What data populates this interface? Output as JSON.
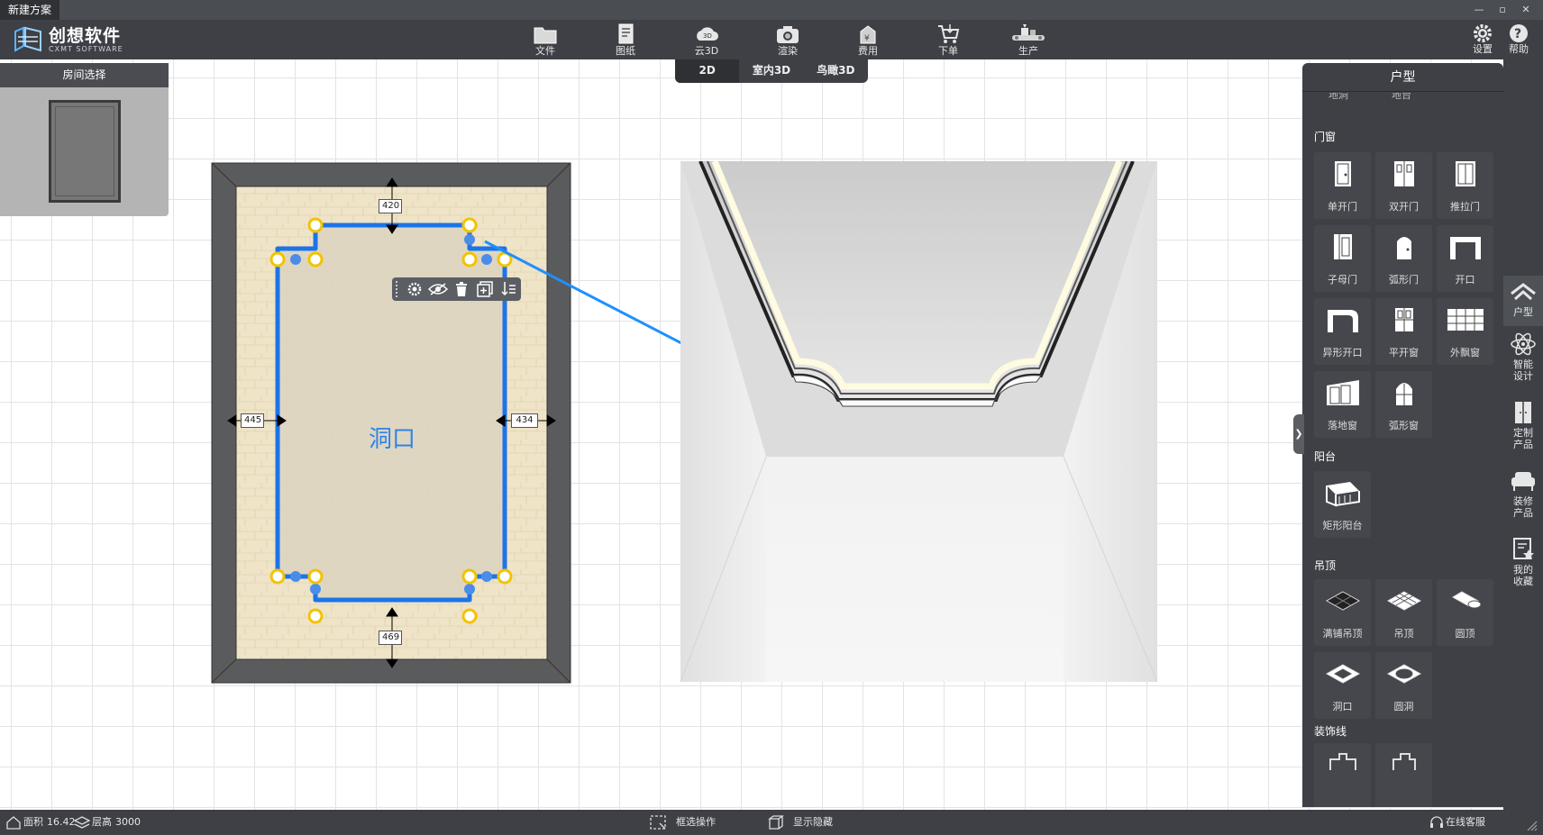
{
  "window": {
    "title": "新建方案",
    "controls": [
      "—",
      "▫",
      "✕"
    ]
  },
  "logo": {
    "main": "创想软件",
    "sub": "CXMT SOFTWARE"
  },
  "toolbar": [
    {
      "label": "文件",
      "icon": "folder-icon"
    },
    {
      "label": "图纸",
      "icon": "drawing-icon"
    },
    {
      "label": "云3D",
      "icon": "cloud-3d-icon"
    },
    {
      "label": "渲染",
      "icon": "camera-icon"
    },
    {
      "label": "费用",
      "icon": "cost-icon"
    },
    {
      "label": "下单",
      "icon": "cart-icon"
    },
    {
      "label": "生产",
      "icon": "production-icon"
    }
  ],
  "toolbar_right": [
    {
      "label": "设置",
      "icon": "gear-icon"
    },
    {
      "label": "帮助",
      "icon": "help-icon"
    }
  ],
  "view_tabs": [
    {
      "label": "2D",
      "active": true
    },
    {
      "label": "室内3D",
      "active": false
    },
    {
      "label": "鸟瞰3D",
      "active": false
    }
  ],
  "room_select": {
    "title": "房间选择"
  },
  "plan": {
    "label": "洞口",
    "dims": {
      "top": "420",
      "left": "445",
      "right": "434",
      "bottom": "469"
    }
  },
  "ceiling_toolbar": [
    "settings-icon",
    "eye-icon",
    "trash-icon",
    "copy-icon",
    "sort-icon"
  ],
  "right_panel": {
    "title": "户型",
    "partial_labels": [
      "地洞",
      "地台"
    ],
    "sections": [
      {
        "title": "门窗",
        "items": [
          "单开门",
          "双开门",
          "推拉门",
          "子母门",
          "弧形门",
          "开口",
          "异形开口",
          "平开窗",
          "外飘窗",
          "落地窗",
          "弧形窗"
        ]
      },
      {
        "title": "阳台",
        "items": [
          "矩形阳台"
        ]
      },
      {
        "title": "吊顶",
        "items": [
          "满铺吊顶",
          "吊顶",
          "圆顶",
          "洞口",
          "圆洞"
        ]
      },
      {
        "title": "装饰线",
        "items": []
      }
    ]
  },
  "sidebar": [
    {
      "label": "户型",
      "active": true
    },
    {
      "label": "智能\n设计",
      "active": false
    },
    {
      "label": "定制\n产品",
      "active": false
    },
    {
      "label": "装修\n产品",
      "active": false
    },
    {
      "label": "我的\n收藏",
      "active": false
    }
  ],
  "status": {
    "area_label": "面积",
    "area_value": "16.42",
    "height_label": "层高",
    "height_value": "3000",
    "box_select": "框选操作",
    "show_hide": "显示隐藏",
    "online_service": "在线客服"
  }
}
